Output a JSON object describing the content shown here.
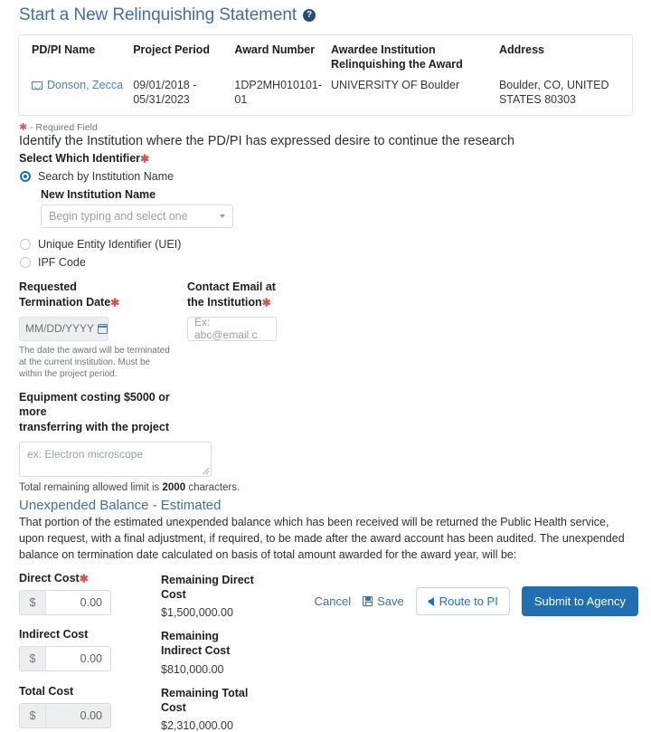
{
  "title": "Start a New Relinquishing Statement",
  "help_icon_label": "?",
  "summary": {
    "headers": [
      "PD/PI Name",
      "Project Period",
      "Award Number",
      "Awardee Institution Relinquishing the Award",
      "Address"
    ],
    "pi_name": "Donson, Zecca",
    "project_period": "09/01/2018 - 05/31/2023",
    "award_number": "1DP2MH010101-01",
    "institution": "UNIVERSITY OF Boulder",
    "address": "Boulder, CO, UNITED STATES 80303"
  },
  "required_note": "- Required Field",
  "lead_text": "Identify the Institution where the PD/PI has expressed desire to continue the research",
  "identifier": {
    "label": "Select Which Identifier",
    "options": [
      {
        "label": "Search by Institution Name",
        "selected": true
      },
      {
        "label": "Unique Entity Identifier (UEI)",
        "selected": false
      },
      {
        "label": "IPF Code",
        "selected": false
      }
    ],
    "institution_label": "New Institution Name",
    "institution_placeholder": "Begin typing and select one"
  },
  "termination": {
    "label_line1": "Requested",
    "label_line2": "Termination  Date",
    "placeholder": "MM/DD/YYYY",
    "helper": "The date the award  will be terminated at the current institution. Must be within the project period."
  },
  "contact_email": {
    "label_line1": "Contact Email at",
    "label_line2": "the Institution",
    "placeholder": "Ex: abc@email.c"
  },
  "equipment": {
    "label_line1": "Equipment costing $5000 or more",
    "label_line2": "transferring with the project",
    "placeholder": "ex: Electron microscope",
    "limit_prefix": "Total remaining allowed limit is",
    "limit_count": "2000",
    "limit_suffix": "characters."
  },
  "unexpended": {
    "heading": "Unexpended Balance - Estimated",
    "paragraph": "That portion of the estimated unexpended balance which has been received will be returned the Public Health service, upon request, with a final adjustment, if required, to be made after the award account has been audited. The unexpended balance on termination date calculated on basis of total amount awarded for the award year, will be:"
  },
  "costs": [
    {
      "label": "Direct Cost",
      "required": true,
      "prefix": "$",
      "value": "0.00",
      "disabled": false,
      "remaining_label_line1": "Remaining Direct",
      "remaining_label_line2": "Cost",
      "remaining_value": "$1,500,000.00"
    },
    {
      "label": "Indirect Cost",
      "required": false,
      "prefix": "$",
      "value": "0.00",
      "disabled": false,
      "remaining_label_line1": "Remaining",
      "remaining_label_line2": "Indirect Cost",
      "remaining_value": "$810,000.00"
    },
    {
      "label": "Total Cost",
      "required": false,
      "prefix": "$",
      "value": "0.00",
      "disabled": true,
      "remaining_label_line1": "Remaining Total",
      "remaining_label_line2": "Cost",
      "remaining_value": "$2,310,000.00"
    }
  ],
  "actions": {
    "cancel": "Cancel",
    "save": "Save",
    "route": "Route to PI",
    "submit": "Submit to Agency"
  },
  "colors": {
    "accent_blue": "#3E6FA8",
    "primary_button": "#1F6FB2",
    "required_red": "#d9534f",
    "link_blue": "#4a7fbd"
  }
}
